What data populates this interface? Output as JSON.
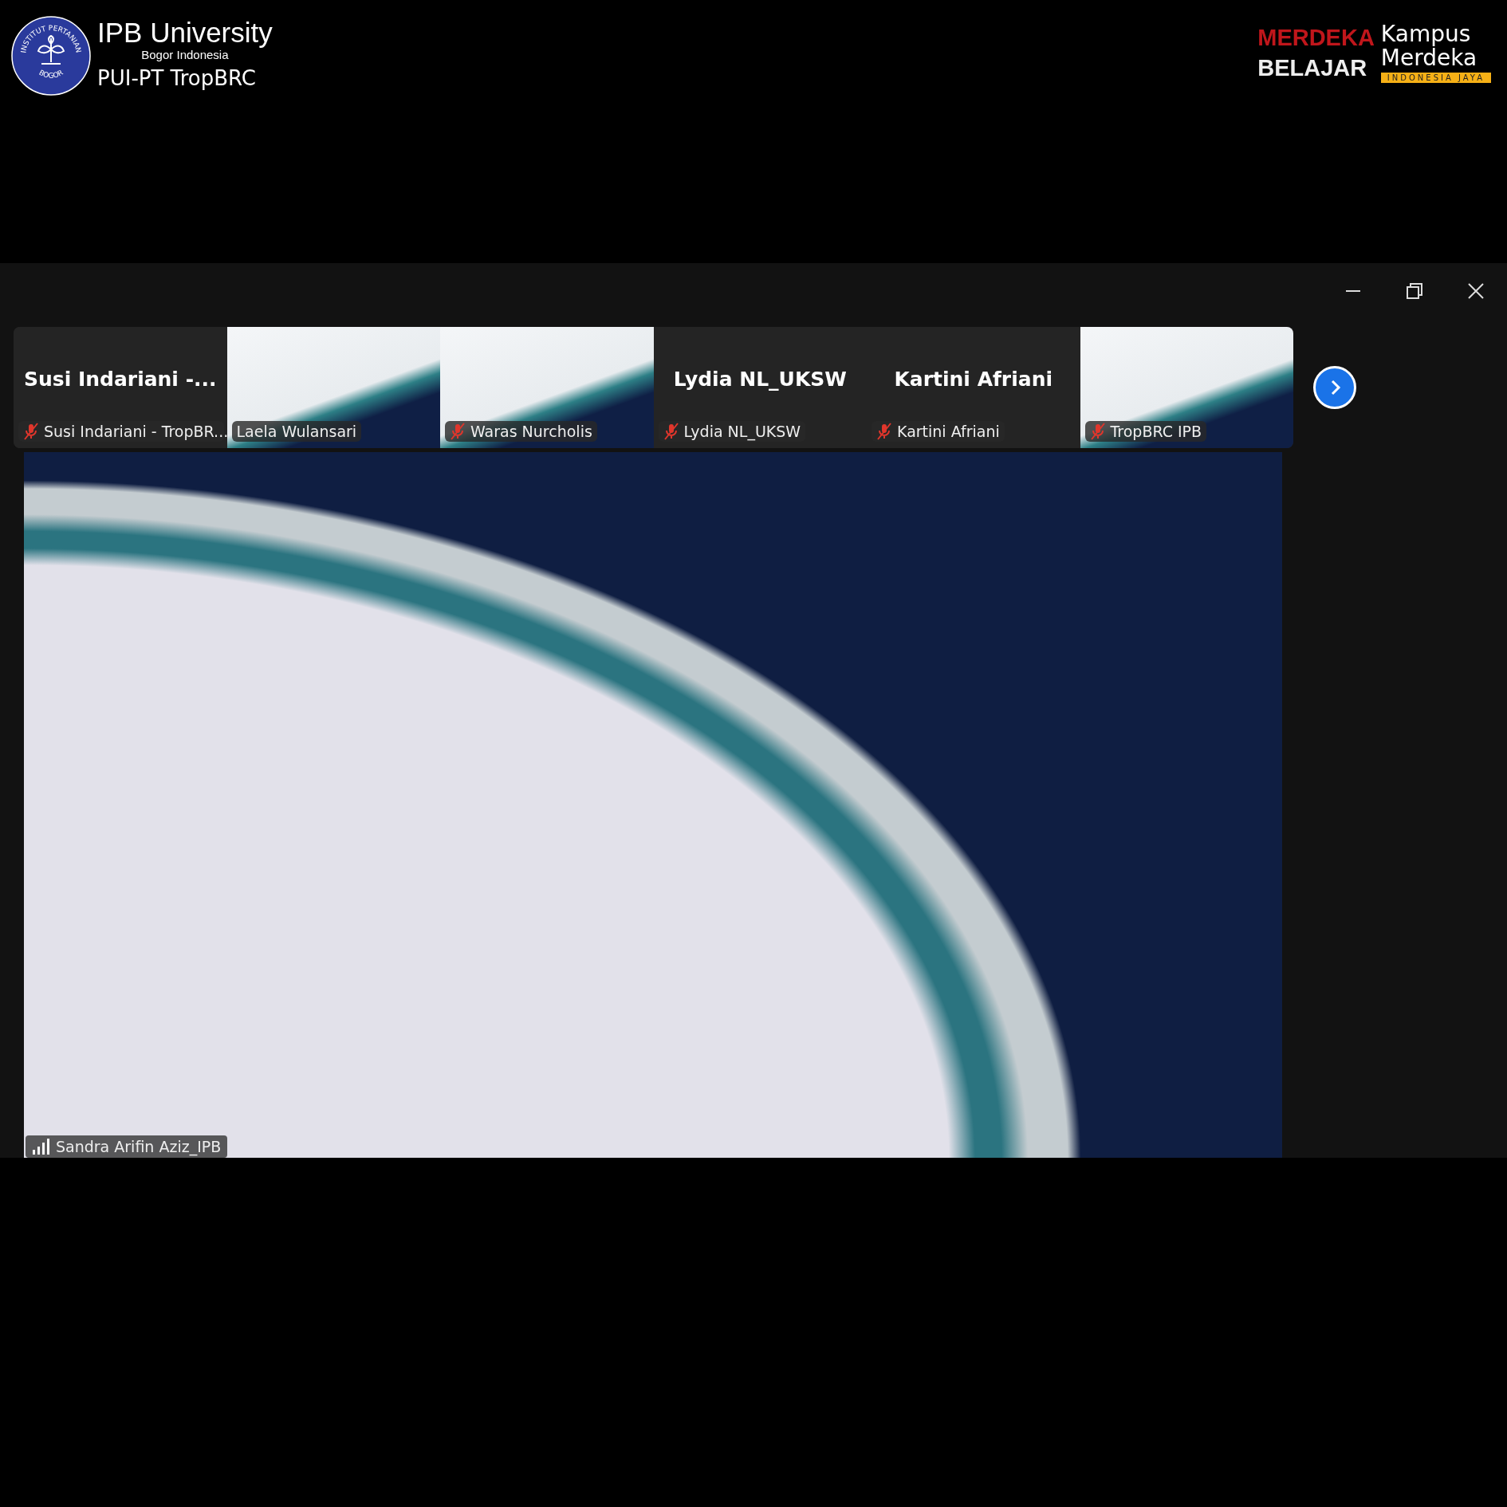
{
  "header": {
    "left_logo": {
      "seal_top": "INSTITUT PERTANIAN",
      "seal_bottom": "BOGOR",
      "title": "IPB University",
      "subtitle": "Bogor Indonesia",
      "unit": "PUI-PT TropBRC"
    },
    "right_logo": {
      "line_1": "MERDEKA",
      "line_2": "BELAJAR",
      "line_3": "Kampus",
      "line_4": "Merdeka",
      "ribbon": "INDONESIA JAYA"
    }
  },
  "participants": [
    {
      "kind": "avatar",
      "tile_name": "Susi Indariani -...",
      "label": "Susi Indariani - TropBR...",
      "muted": true
    },
    {
      "kind": "video",
      "label": "Laela Wulansari",
      "muted": false
    },
    {
      "kind": "video",
      "label": "Waras Nurcholis",
      "muted": true
    },
    {
      "kind": "avatar",
      "tile_name": "Lydia NL_UKSW",
      "label": "Lydia NL_UKSW",
      "muted": true
    },
    {
      "kind": "avatar",
      "tile_name": "Kartini Afriani",
      "label": "Kartini Afriani",
      "muted": true
    },
    {
      "kind": "video",
      "label": "TropBRC IPB",
      "muted": true
    }
  ],
  "speaker": {
    "label": "Sandra Arifin Aziz_IPB"
  }
}
